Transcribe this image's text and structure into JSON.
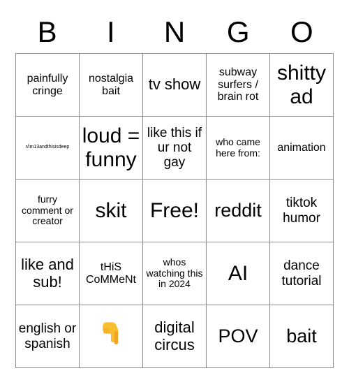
{
  "card": {
    "header_letters": [
      "B",
      "I",
      "N",
      "G",
      "O"
    ],
    "rows": [
      [
        {
          "text": "painfully cringe",
          "size": "sm"
        },
        {
          "text": "nostalgia bait",
          "size": "sm"
        },
        {
          "text": "tv show",
          "size": "lg"
        },
        {
          "text": "subway surfers / brain rot",
          "size": "sm"
        },
        {
          "text": "shitty ad",
          "size": "xxl"
        }
      ],
      [
        {
          "text": "r/im13andthisisdeep",
          "size": "tiny"
        },
        {
          "text": "loud = funny",
          "size": "xxl"
        },
        {
          "text": "like this if ur not gay",
          "size": "md"
        },
        {
          "text": "who came here from:",
          "size": "xs"
        },
        {
          "text": "animation",
          "size": "sm"
        }
      ],
      [
        {
          "text": "furry comment or creator",
          "size": "xs"
        },
        {
          "text": "skit",
          "size": "xxl"
        },
        {
          "text": "Free!",
          "size": "xxl"
        },
        {
          "text": "reddit",
          "size": "xl"
        },
        {
          "text": "tiktok humor",
          "size": "md"
        }
      ],
      [
        {
          "text": "like and sub!",
          "size": "lg"
        },
        {
          "text": "tHiS CoMMeNt",
          "size": "sm"
        },
        {
          "text": "whos watching this in 2024",
          "size": "xs"
        },
        {
          "text": "AI",
          "size": "xxl"
        },
        {
          "text": "dance tutorial",
          "size": "md"
        }
      ],
      [
        {
          "text": "english or spanish",
          "size": "md"
        },
        {
          "text": "👇",
          "size": "emoji",
          "icon": "pointing-down-hand-emoji"
        },
        {
          "text": "digital circus",
          "size": "lg"
        },
        {
          "text": "POV",
          "size": "xl"
        },
        {
          "text": "bait",
          "size": "xl"
        }
      ]
    ],
    "free_space": {
      "row": 2,
      "col": 2,
      "label": "Free!"
    },
    "colors": {
      "background": "#ffffff",
      "text": "#000000",
      "grid_line": "#8d8d8d",
      "emoji_yellow": "#f7bf30"
    }
  }
}
